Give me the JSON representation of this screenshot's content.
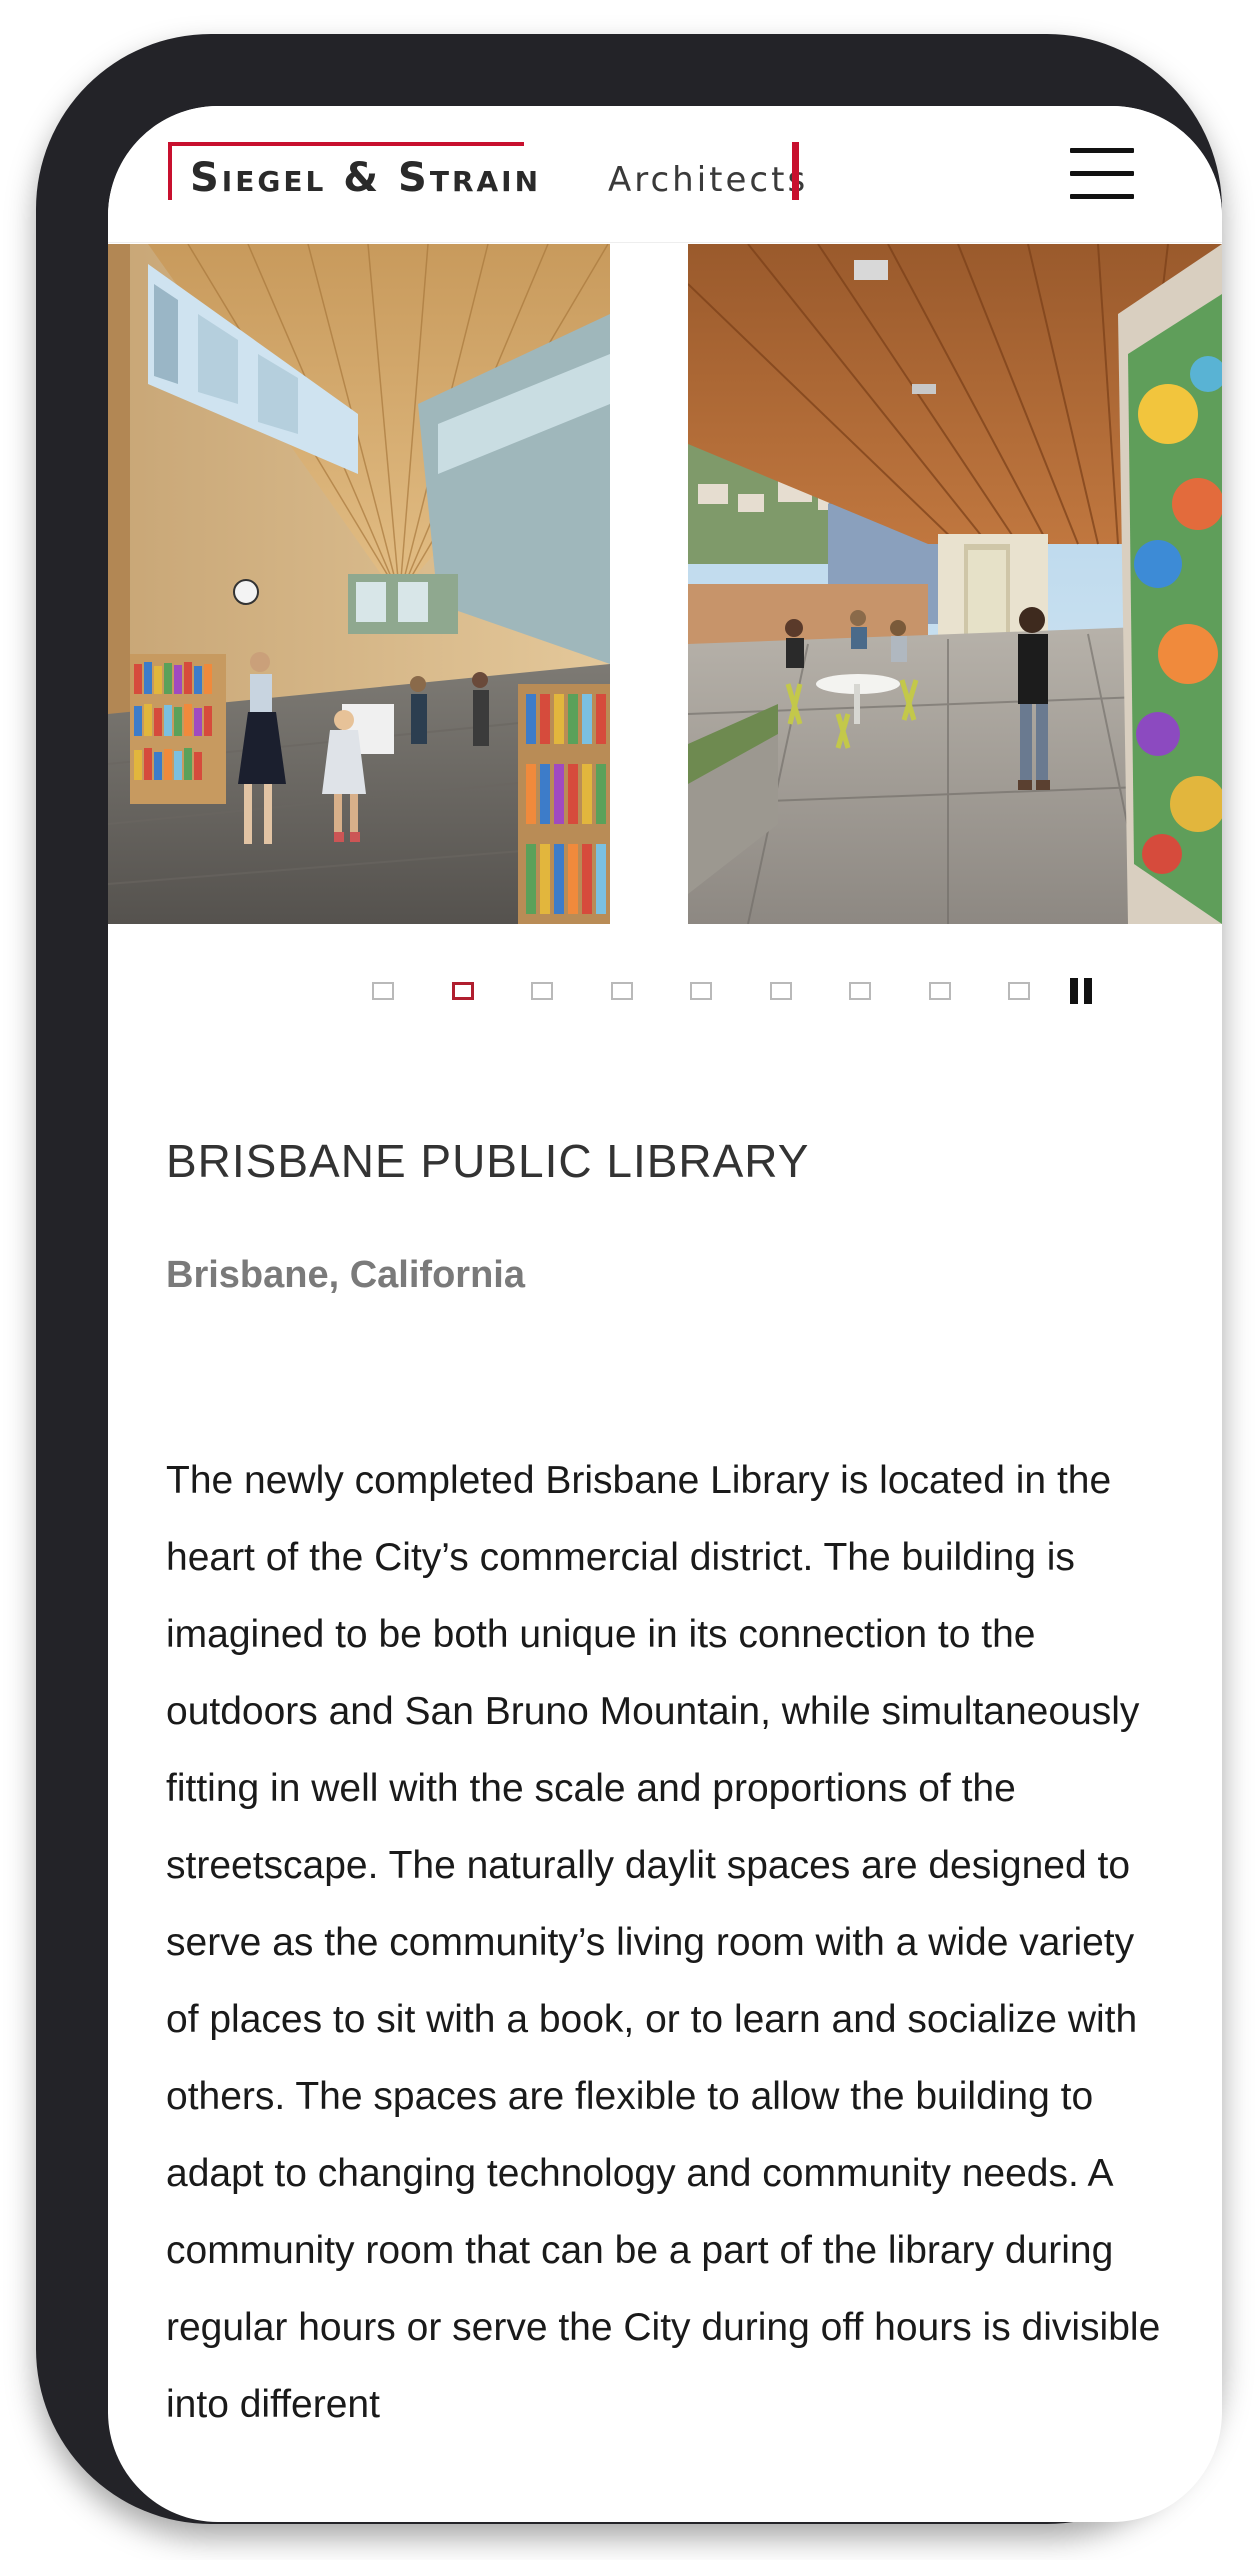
{
  "header": {
    "logo_name": "Siegel & Strain",
    "logo_sub": "Architects",
    "brand_color": "#c8102e",
    "menu_icon": "hamburger-menu-icon"
  },
  "slider": {
    "slides": [
      {
        "alt": "Library interior reading area"
      },
      {
        "alt": "Covered outdoor patio with mural"
      }
    ],
    "dot_count": 9,
    "active_dot": 2,
    "active_color": "#b01e2e",
    "pause_icon": "pause-icon"
  },
  "project": {
    "title": "BRISBANE PUBLIC LIBRARY",
    "location": "Brisbane, California",
    "description": "The newly completed Brisbane Library is located in the heart of the City’s commercial district. The building is imagined to be both unique in its connection to the outdoors and San Bruno Mountain, while simultaneously fitting in well with the scale and proportions of the streetscape. The naturally daylit spaces are designed to serve as the community’s living room with a wide variety of places to sit with a book, or to learn and socialize with others. The spaces are flexible to allow the building to adapt to changing technology and community needs. A community room that can be a part of the library during regular hours or serve the City during off hours is divisible into different"
  }
}
